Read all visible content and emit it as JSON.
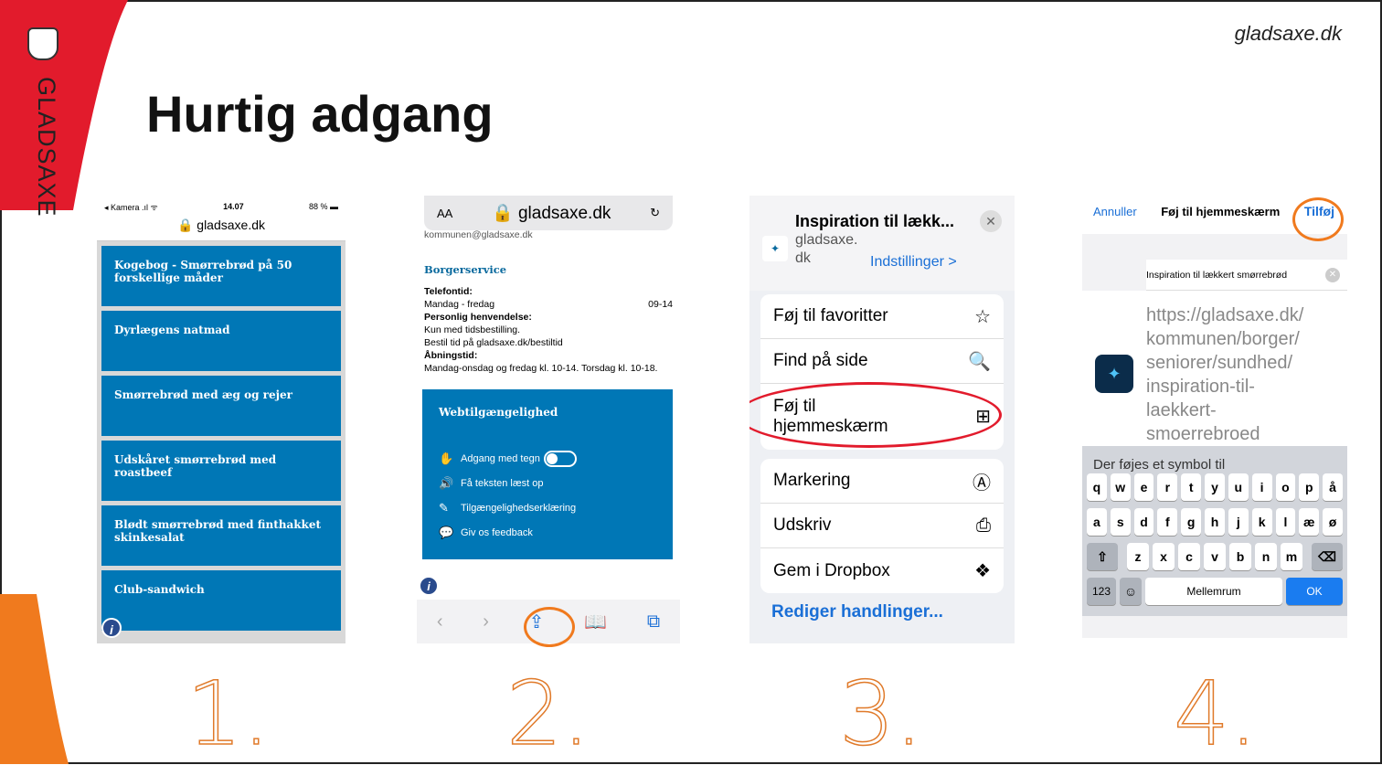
{
  "header": {
    "site_url": "gladsaxe.dk",
    "title": "Hurtig adgang",
    "brand": "GLADSAXE"
  },
  "colors": {
    "brand_red": "#e21b2c",
    "brand_orange": "#f07a1e",
    "blue": "#0077b6",
    "ios_blue": "#1a6fd6"
  },
  "step_numbers": [
    "1.",
    "2.",
    "3.",
    "4."
  ],
  "screen1": {
    "status_left": "◂ Kamera .ıl ᯤ",
    "status_time": "14.07",
    "status_right": "88 % ▬",
    "url": "🔒 gladsaxe.dk",
    "cards": [
      "Kogebog - Smørrebrød på 50 forskellige måder",
      "Dyrlægens natmad",
      "Smørrebrød med æg og rejer",
      "Udskåret smørrebrød med roastbeef",
      "Blødt smørrebrød med finthakket skinkesalat",
      "Club-sandwich"
    ],
    "info_label": "i"
  },
  "screen2": {
    "aa": "AA",
    "host": "🔒 gladsaxe.dk",
    "reload": "↻",
    "clipped_line": "kommunen@gladsaxe.dk",
    "section": "Borgerservice",
    "lines": [
      "Telefontid:",
      "Mandag - fredag",
      "Personlig henvendelse:",
      "Kun med tidsbestilling.",
      "Bestil tid på gladsaxe.dk/bestiltid",
      "Åbningstid:",
      " Mandag-onsdag og fredag kl. 10-14. Torsdag kl. 10-18."
    ],
    "phone_hours": "09-14",
    "panel_title": "Webtilgængelighed",
    "panel_rows": [
      "Adgang med tegn",
      "Få teksten læst op",
      "Tilgængelighedserklæring",
      "Giv os feedback"
    ],
    "toolbar": [
      "‹",
      "›",
      "⇪",
      "📖",
      "⧉"
    ],
    "info_label": "i"
  },
  "screen3": {
    "title": "Inspiration til lækk...",
    "domain": "gladsaxe.\ndk",
    "settings": "Indstillinger >",
    "close": "✕",
    "favicon": "✦",
    "items": [
      {
        "label": "Føj til favoritter",
        "icon": "☆"
      },
      {
        "label": "Find på side",
        "icon": "🔍"
      },
      {
        "label": "Føj til hjemmeskærm",
        "icon": "⊞"
      }
    ],
    "items2": [
      {
        "label": "Markering",
        "icon": "Ⓐ"
      },
      {
        "label": "Udskriv",
        "icon": "⎙"
      },
      {
        "label": "Gem i Dropbox",
        "icon": "❖"
      }
    ],
    "edit_actions": "Rediger handlinger..."
  },
  "screen4": {
    "cancel": "Annuller",
    "nav_title": "Føj til hjemmeskærm",
    "add": "Tilføj",
    "name_value": "Inspiration til lækkert smørrebrød",
    "clear": "✕",
    "url_lines": [
      "https://gladsaxe.dk/",
      "kommunen/borger/",
      "seniorer/sundhed/",
      "inspiration-til-",
      "laekkert-",
      "smoerrebroed"
    ],
    "hint": "Der føjes et symbol til",
    "keys_row1": [
      "q",
      "w",
      "e",
      "r",
      "t",
      "y",
      "u",
      "i",
      "o",
      "p",
      "å"
    ],
    "keys_row2": [
      "a",
      "s",
      "d",
      "f",
      "g",
      "h",
      "j",
      "k",
      "l",
      "æ",
      "ø"
    ],
    "keys_row3": [
      "z",
      "x",
      "c",
      "v",
      "b",
      "n",
      "m"
    ],
    "shift": "⇧",
    "backspace": "⌫",
    "num_key": "123",
    "emoji_key": "☺",
    "space_key": "Mellemrum",
    "ok_key": "OK"
  }
}
